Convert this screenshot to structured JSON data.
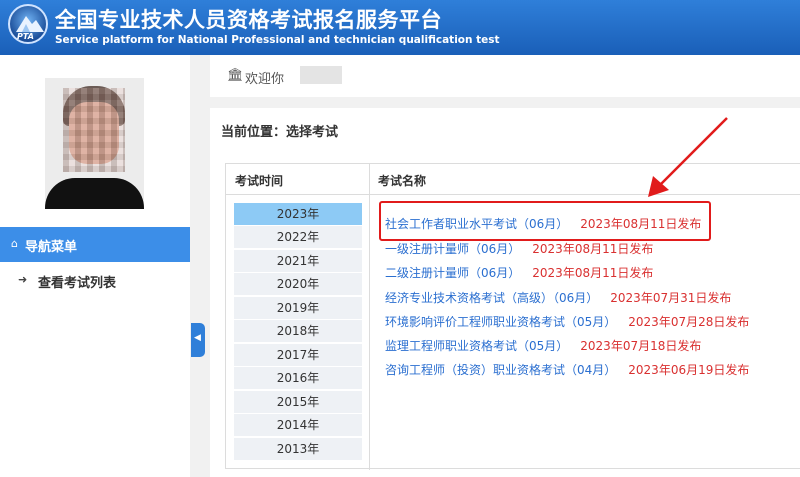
{
  "header": {
    "logo_text": "PTA",
    "title_cn": "全国专业技术人员资格考试报名服务平台",
    "title_en": "Service platform for National Professional and technician qualification test"
  },
  "sidebar": {
    "nav_menu_label": "导航菜单",
    "items": [
      {
        "label": "查看考试列表"
      }
    ]
  },
  "welcome": {
    "label": "欢迎你"
  },
  "breadcrumb": {
    "label": "当前位置：选择考试"
  },
  "table": {
    "col_time": "考试时间",
    "col_name": "考试名称"
  },
  "years": [
    "2023年",
    "2022年",
    "2021年",
    "2020年",
    "2019年",
    "2018年",
    "2017年",
    "2016年",
    "2015年",
    "2014年",
    "2013年"
  ],
  "selected_year": "2023年",
  "exams": [
    {
      "name": "社会工作者职业水平考试（06月）",
      "date": "2023年08月11日发布"
    },
    {
      "name": "一级注册计量师（06月）",
      "date": "2023年08月11日发布"
    },
    {
      "name": "二级注册计量师（06月）",
      "date": "2023年08月11日发布"
    },
    {
      "name": "经济专业技术资格考试（高级）（06月）",
      "date": "2023年07月31日发布"
    },
    {
      "name": "环境影响评价工程师职业资格考试（05月）",
      "date": "2023年07月28日发布"
    },
    {
      "name": "监理工程师职业资格考试（05月）",
      "date": "2023年07月18日发布"
    },
    {
      "name": "咨询工程师（投资）职业资格考试（04月）",
      "date": "2023年06月19日发布"
    }
  ],
  "colors": {
    "header_blue": "#2f7fd9",
    "nav_active": "#3c8ee8",
    "link_blue": "#2b6fd0",
    "date_red": "#d93030",
    "selected_year_bg": "#8dcaf5",
    "annotation_red": "#e11b1b"
  },
  "icons": {
    "nav_menu": "home-icon",
    "nav_item": "sign-in-icon",
    "welcome": "bank-icon",
    "collapse": "chevron-left-icon"
  }
}
